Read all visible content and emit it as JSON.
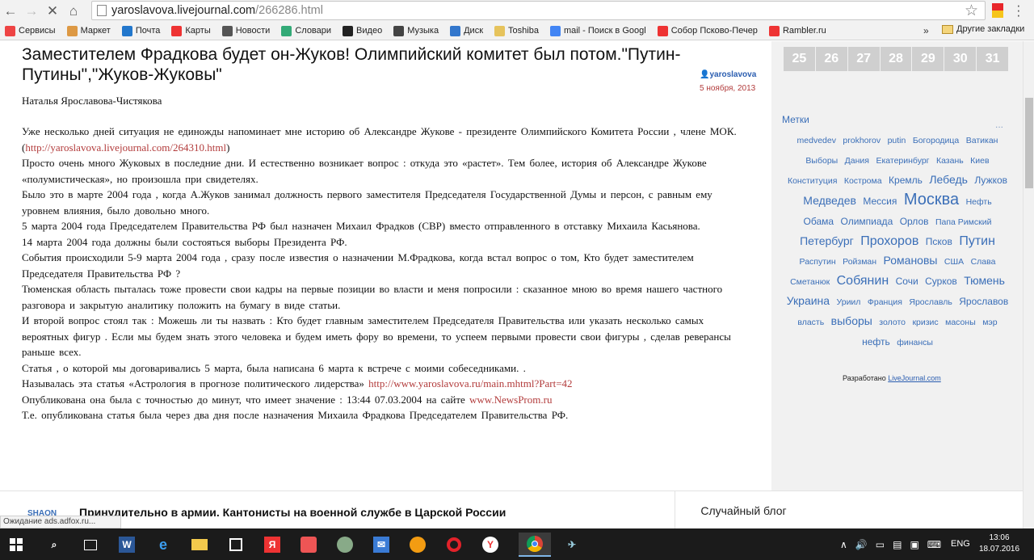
{
  "browser": {
    "url_host": "yaroslavova.livejournal.com",
    "url_path": "/266286.html",
    "bookmarks": [
      {
        "label": "Сервисы",
        "color": "#e44"
      },
      {
        "label": "Маркет",
        "color": "#d94"
      },
      {
        "label": "Почта",
        "color": "#27c"
      },
      {
        "label": "Карты",
        "color": "#e33"
      },
      {
        "label": "Новости",
        "color": "#555"
      },
      {
        "label": "Словари",
        "color": "#3a7"
      },
      {
        "label": "Видео",
        "color": "#222"
      },
      {
        "label": "Музыка",
        "color": "#444"
      },
      {
        "label": "Диск",
        "color": "#37c"
      },
      {
        "label": "Toshiba",
        "color": "#e6c35c"
      },
      {
        "label": "mail - Поиск в Googl",
        "color": "#4285f4"
      },
      {
        "label": "Собор Псково-Печер",
        "color": "#e33"
      },
      {
        "label": "Rambler.ru",
        "color": "#e33"
      }
    ],
    "more": "»",
    "other_bookmarks": "Другие закладки"
  },
  "article": {
    "title": "Заместителем Фрадкова будет он-Жуков! Олимпийский комитет был потом.\"Путин- Путины\",\"Жуков-Жуковы\"",
    "author": "yaroslavova",
    "date": "5 ноября, 2013",
    "byline": "Наталья  Ярославова-Чистякова",
    "paragraphs": [
      {
        "text": "Уже  несколько    дней  ситуация   не единожды напоминает   мне  историю  об  Александре Жукове - президенте   Олимпийского Комитета    России ,  члене  МОК. (",
        "link": "http://yaroslavova.livejournal.com/264310.html",
        "after": ")"
      },
      {
        "text": "Просто  очень    много Жуковых   в последние  дни.  И   естественно возникает вопрос : откуда   это «растет».    Тем  более,  история   об    Александре  Жукове  «полумистическая», но  произошла  при свидетелях."
      },
      {
        "text": "Было  это    в   марте  2004 года , когда  А.Жуков    занимал  должность      первого  заместителя  Председателя Государственной Думы и персон,  с равным    ему     уровнем влияния,   было   довольно  много."
      },
      {
        "text": "5  марта   2004 года   Председателем     Правительства   РФ   был назначен      Михаил   Фрадков (СВР)  вместо   отправленного  в отставку      Михаила   Касьянова."
      },
      {
        "text": "14 марта  2004      года           должны  были состояться   выборы  Президента  РФ."
      },
      {
        "text": "События   происходили   5-9 марта      2004 года   , сразу    после известия  о  назначении М.Фрадкова, когда  встал      вопрос о том,  Кто  будет    заместителем  Председателя  Правительства РФ ?"
      },
      {
        "text": "Тюменская   область   пыталась тоже   провести свои кадры  на первые  позиции во власти и   меня  попросили : сказанное  мною  во   время      нашего     частного    разговора  и   закрытую  аналитику   положить на  бумагу в     виде   статьи."
      },
      {
        "text": "И  второй  вопрос  стоял  так :   Можешь  ли ты   назвать : Кто будет   главным  заместителем    Председателя  Правительства  или указать несколько самых  вероятных  фигур .  Если   мы    будем  знать        этого человека  и  будем иметь  фору  во времени,  то успеем первыми    провести   свои   фигуры ,  сделав реверансы  раньше всех."
      },
      {
        "text": "Статья  , о которой    мы  договаривались   5 марта,       была написана     6 марта  к встрече    с моими    собеседниками. ."
      },
      {
        "text": "Называлась   эта     статья    «Астрология в прогнозе политического лидерства» ",
        "link": "http://www.yaroslavova.ru/main.mhtml?Part=42",
        "after": ""
      },
      {
        "text": "            Опубликована   она была  с точностью до минут,    что имеет   значение : 13:44 07.03.2004 на сайте  ",
        "link": "www.NewsProm.ru",
        "after": ""
      },
      {
        "text": "           Т.е.   опубликована         статья  была  через  два   дня  после назначения  Михаила   Фрадкова   Председателем  Правительства   РФ."
      }
    ]
  },
  "sidebar": {
    "calendar_days": [
      "25",
      "26",
      "27",
      "28",
      "29",
      "30",
      "31"
    ],
    "tags_title": "Метки",
    "tags_more": "...",
    "tags": [
      {
        "t": "medvedev",
        "s": "s10"
      },
      {
        "t": "prokhorov",
        "s": "s10"
      },
      {
        "t": "putin",
        "s": "s10"
      },
      {
        "t": "Богородица",
        "s": "s10"
      },
      {
        "t": "Ватикан",
        "s": "s10"
      },
      {
        "t": "Выборы",
        "s": "s10"
      },
      {
        "t": "Дания",
        "s": "s10"
      },
      {
        "t": "Екатеринбург",
        "s": "s10"
      },
      {
        "t": "Казань",
        "s": "s10"
      },
      {
        "t": "Киев",
        "s": "s10"
      },
      {
        "t": "Конституция",
        "s": "s10"
      },
      {
        "t": "Кострома",
        "s": "s10"
      },
      {
        "t": "Кремль",
        "s": "s12"
      },
      {
        "t": "Лебедь",
        "s": "s14"
      },
      {
        "t": "Лужков",
        "s": "s12"
      },
      {
        "t": "Медведев",
        "s": "s14"
      },
      {
        "t": "Мессия",
        "s": "s12"
      },
      {
        "t": "Москва",
        "s": "s20"
      },
      {
        "t": "Нефть",
        "s": "s10"
      },
      {
        "t": "Обама",
        "s": "s12"
      },
      {
        "t": "Олимпиада",
        "s": "s12"
      },
      {
        "t": "Орлов",
        "s": "s12"
      },
      {
        "t": "Папа Римский",
        "s": "s10"
      },
      {
        "t": "Петербург",
        "s": "s14"
      },
      {
        "t": "Прохоров",
        "s": "s16"
      },
      {
        "t": "Псков",
        "s": "s12"
      },
      {
        "t": "Путин",
        "s": "s16"
      },
      {
        "t": "Распутин",
        "s": "s10"
      },
      {
        "t": "Ройзман",
        "s": "s10"
      },
      {
        "t": "Романовы",
        "s": "s14"
      },
      {
        "t": "США",
        "s": "s10"
      },
      {
        "t": "Слава",
        "s": "s10"
      },
      {
        "t": "Сметанюк",
        "s": "s10"
      },
      {
        "t": "Собянин",
        "s": "s16"
      },
      {
        "t": "Сочи",
        "s": "s12"
      },
      {
        "t": "Сурков",
        "s": "s12"
      },
      {
        "t": "Тюмень",
        "s": "s14"
      },
      {
        "t": "Украина",
        "s": "s14"
      },
      {
        "t": "Уриил",
        "s": "s10"
      },
      {
        "t": "Франция",
        "s": "s10"
      },
      {
        "t": "Ярославль",
        "s": "s10"
      },
      {
        "t": "Ярославов",
        "s": "s12"
      },
      {
        "t": "власть",
        "s": "s10"
      },
      {
        "t": "выборы",
        "s": "s14"
      },
      {
        "t": "золото",
        "s": "s10"
      },
      {
        "t": "кризис",
        "s": "s10"
      },
      {
        "t": "масоны",
        "s": "s10"
      },
      {
        "t": "мэр",
        "s": "s10"
      },
      {
        "t": "нефть",
        "s": "s12"
      },
      {
        "t": "финансы",
        "s": "s10"
      }
    ],
    "powered_prefix": "Разработано ",
    "powered_link": "LiveJournal.com"
  },
  "bottom": {
    "user": "SHAON",
    "post_title": "Принудительно в армии. Кантонисты на военной службе в Царской России",
    "random": "Случайный блог",
    "status": "Ожидание ads.adfox.ru..."
  },
  "taskbar": {
    "lang": "ENG",
    "time": "13:06",
    "date": "18.07.2016"
  }
}
